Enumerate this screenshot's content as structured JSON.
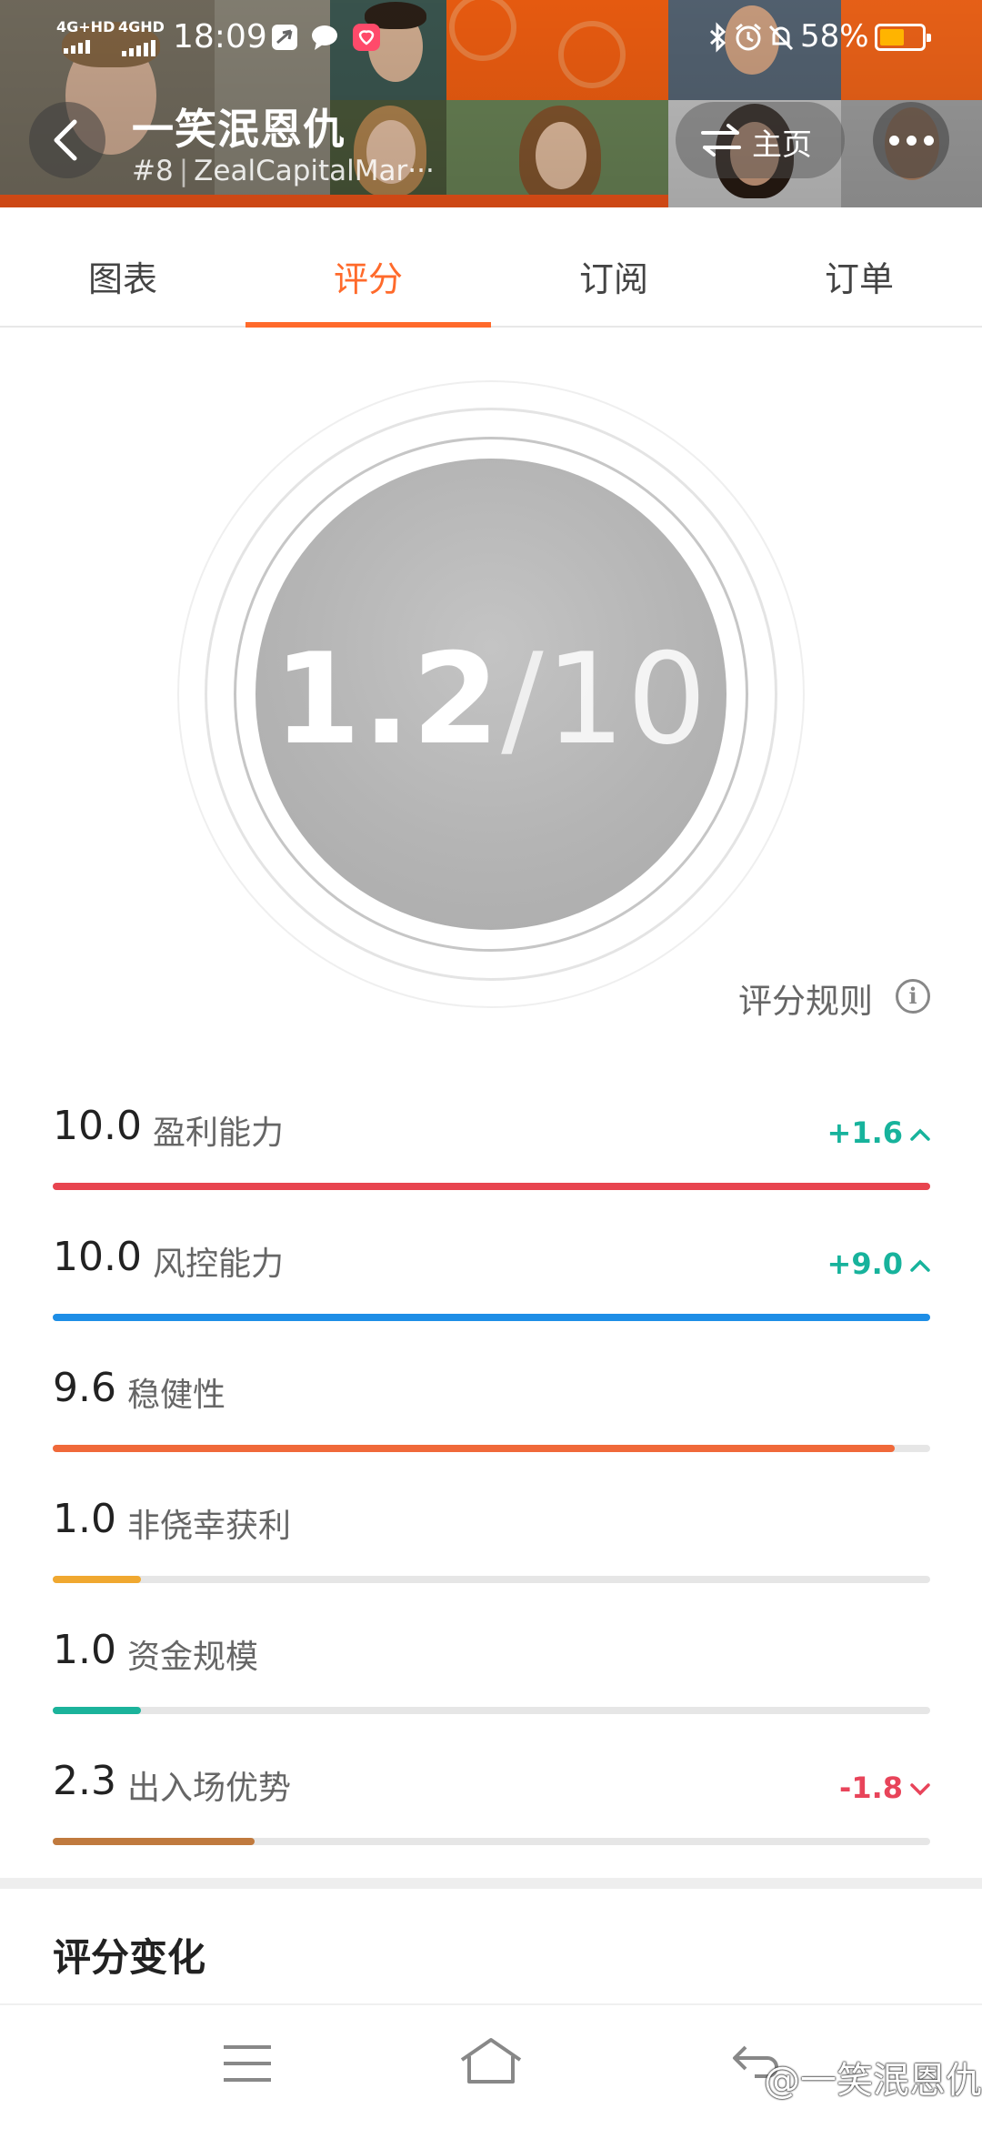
{
  "status_bar": {
    "network1": "4G+HD",
    "network2": "4GHD",
    "time": "18:09",
    "battery": "58%",
    "battery_level": 0.58
  },
  "header": {
    "user_name": "一笑泯恩仇",
    "rank": "#8",
    "broker": "ZealCapitalMar···",
    "home_label": "主页"
  },
  "tabs": [
    {
      "label": "图表",
      "active": false
    },
    {
      "label": "评分",
      "active": true
    },
    {
      "label": "订阅",
      "active": false
    },
    {
      "label": "订单",
      "active": false
    }
  ],
  "score": {
    "value": "1.2",
    "separator": "/",
    "max": "10",
    "rules_label": "评分规则"
  },
  "metrics": [
    {
      "value": "10.0",
      "label": "盈利能力",
      "level": 1.0,
      "color": "#e8444f",
      "delta": "+1.6",
      "trend": "up"
    },
    {
      "value": "10.0",
      "label": "风控能力",
      "level": 1.0,
      "color": "#1e8ee6",
      "delta": "+9.0",
      "trend": "up"
    },
    {
      "value": "9.6",
      "label": "稳健性",
      "level": 0.96,
      "color": "#f0693a",
      "delta": "",
      "trend": ""
    },
    {
      "value": "1.0",
      "label": "非侥幸获利",
      "level": 0.1,
      "color": "#f0a830",
      "delta": "",
      "trend": ""
    },
    {
      "value": "1.0",
      "label": "资金规模",
      "level": 0.1,
      "color": "#1bb39b",
      "delta": "",
      "trend": ""
    },
    {
      "value": "2.3",
      "label": "出入场优势",
      "level": 0.23,
      "color": "#c07a3e",
      "delta": "-1.8",
      "trend": "down"
    }
  ],
  "trend_colors": {
    "up": "#17b39c",
    "down": "#e8445a"
  },
  "section": {
    "title": "评分变化"
  },
  "watermark": "@一笑泯恩仇"
}
